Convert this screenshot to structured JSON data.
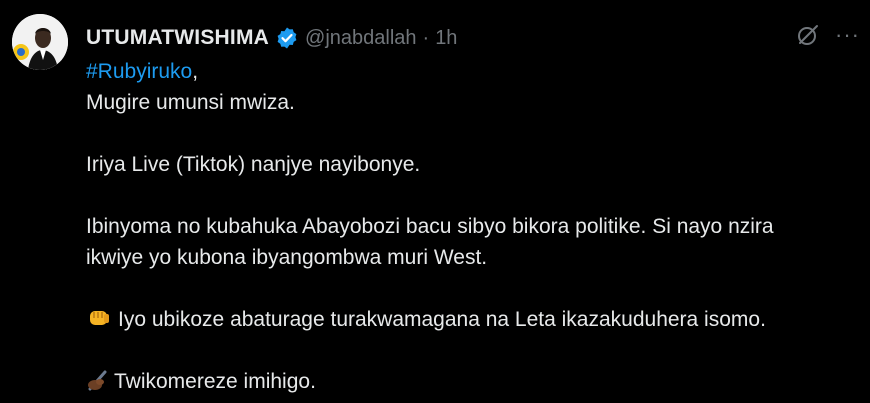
{
  "post": {
    "author_name": "UTUMATWISHIMA",
    "handle": "@jnabdallah",
    "separator": "·",
    "time": "1h",
    "more_label": "···",
    "hashtag": "#Rubyiruko",
    "hashtag_suffix": ",",
    "lines": [
      "Mugire umunsi mwiza.",
      "Iriya Live (Tiktok) nanjye nayibonye.",
      "Ibinyoma no kubahuka Abayobozi bacu sibyo bikora politike. Si nayo nzira",
      "ikwiye yo kubona ibyangombwa muri West.",
      "Iyo ubikoze abaturage turakwamagana na Leta ikazakuduhera isomo.",
      "Twikomereze imihigo."
    ],
    "icons": {
      "verified": "verified-badge-icon",
      "grok": "grok-icon",
      "more": "more-icon",
      "fist": "oncoming-fist-emoji",
      "writing_hand": "writing-hand-emoji"
    },
    "colors": {
      "background": "#000000",
      "text": "#e7e9ea",
      "muted": "#71767b",
      "link": "#1d9bf0",
      "verified": "#1d9bf0"
    }
  }
}
